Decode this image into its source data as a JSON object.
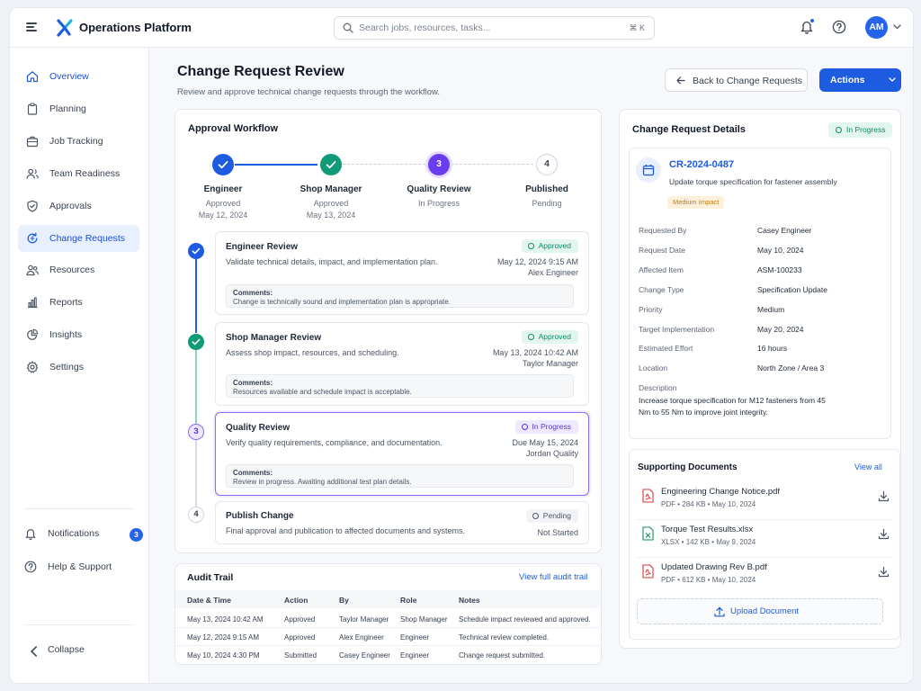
{
  "app": {
    "brand": "Operations Platform",
    "search_placeholder": "Search jobs, resources, tasks...",
    "search_shortcut": "⌘ K",
    "avatar_initials": "AM",
    "colors": {
      "primary": "#1d5be0",
      "success": "#0f9a78",
      "in_progress": "#6b3df0",
      "pending": "#cfd5de",
      "impact": "#f59e0b"
    }
  },
  "sidebar": {
    "items": [
      {
        "label": "Overview",
        "icon": "home-icon"
      },
      {
        "label": "Planning",
        "icon": "clipboard-icon"
      },
      {
        "label": "Job Tracking",
        "icon": "briefcase-icon"
      },
      {
        "label": "Team Readiness",
        "icon": "users-icon"
      },
      {
        "label": "Approvals",
        "icon": "shield-check-icon"
      },
      {
        "label": "Change Requests",
        "icon": "refresh-document-icon"
      },
      {
        "label": "Resources",
        "icon": "people-icon"
      },
      {
        "label": "Reports",
        "icon": "bar-chart-icon"
      },
      {
        "label": "Insights",
        "icon": "pie-chart-icon"
      },
      {
        "label": "Settings",
        "icon": "gear-icon"
      }
    ],
    "active_index": 5,
    "notifications_label": "Notifications",
    "notifications_count": "3",
    "help_label": "Help & Support",
    "collapse_label": "Collapse"
  },
  "header": {
    "title": "Change Request Review",
    "subtitle": "Review and approve technical change requests through the workflow.",
    "back_label": "Back to Change Requests",
    "actions_label": "Actions"
  },
  "workflow": {
    "title": "Approval Workflow",
    "steps": [
      {
        "name": "Engineer",
        "status": "Approved",
        "date": "May 12, 2024",
        "state": "done"
      },
      {
        "name": "Shop Manager",
        "status": "Approved",
        "date": "May 13, 2024",
        "state": "done"
      },
      {
        "name": "Quality Review",
        "status": "In Progress",
        "date": "",
        "number": "3",
        "state": "current"
      },
      {
        "name": "Published",
        "status": "Pending",
        "date": "",
        "number": "4",
        "state": "pending"
      }
    ],
    "reviews": [
      {
        "title": "Engineer Review",
        "desc": "Validate technical details, impact, and implementation plan.",
        "status": "Approved",
        "date": "May 12, 2024 9:15 AM",
        "who": "Alex Engineer",
        "comment_label": "Comments:",
        "comment": "Change is technically sound and implementation plan is appropriate."
      },
      {
        "title": "Shop Manager Review",
        "desc": "Assess shop impact, resources, and scheduling.",
        "status": "Approved",
        "date": "May 13, 2024 10:42 AM",
        "who": "Taylor Manager",
        "comment_label": "Comments:",
        "comment": "Resources available and schedule impact is acceptable."
      },
      {
        "number": "3",
        "title": "Quality Review",
        "desc": "Verify quality requirements, compliance, and documentation.",
        "status": "In Progress",
        "date": "Due May 15, 2024",
        "who": "Jordan Quality",
        "comment_label": "Comments:",
        "comment": "Review in progress. Awaiting additional test plan details."
      },
      {
        "number": "4",
        "title": "Publish Change",
        "desc": "Final approval and publication to affected documents and systems.",
        "status": "Pending",
        "date": "Not Started"
      }
    ]
  },
  "audit": {
    "title": "Audit Trail",
    "link": "View full audit trail",
    "columns": [
      "Date & Time",
      "Action",
      "By",
      "Role",
      "Notes"
    ],
    "rows": [
      [
        "May 13, 2024  10:42 AM",
        "Approved",
        "Taylor Manager",
        "Shop Manager",
        "Schedule impact reviewed and approved."
      ],
      [
        "May 12, 2024  9:15 AM",
        "Approved",
        "Alex Engineer",
        "Engineer",
        "Technical review completed."
      ],
      [
        "May 10, 2024  4:30 PM",
        "Submitted",
        "Casey Engineer",
        "Engineer",
        "Change request submitted."
      ]
    ]
  },
  "details": {
    "title": "Change Request Details",
    "status": "In Progress",
    "cr_id": "CR-2024-0487",
    "cr_summary": "Update torque specification for fastener assembly",
    "impact": "Medium Impact",
    "fields": [
      {
        "label": "Requested By",
        "value": "Casey Engineer"
      },
      {
        "label": "Request Date",
        "value": "May 10, 2024"
      },
      {
        "label": "Affected Item",
        "value": "ASM-100233"
      },
      {
        "label": "Change Type",
        "value": "Specification Update"
      },
      {
        "label": "Priority",
        "value": "Medium"
      },
      {
        "label": "Target Implementation",
        "value": "May 20, 2024"
      },
      {
        "label": "Estimated Effort",
        "value": "16 hours"
      },
      {
        "label": "Location",
        "value": "North Zone / Area 3"
      }
    ],
    "description_label": "Description",
    "description_line1": "Increase torque specification for M12 fasteners from 45",
    "description_line2": "Nm to 55 Nm to improve joint integrity."
  },
  "documents": {
    "title": "Supporting Documents",
    "view_all": "View all",
    "items": [
      {
        "name": "Engineering Change Notice.pdf",
        "meta": "PDF   •   284 KB   •   May 10, 2024",
        "type": "pdf"
      },
      {
        "name": "Torque Test Results.xlsx",
        "meta": "XLSX   •   142 KB   •   May 9, 2024",
        "type": "xlsx"
      },
      {
        "name": "Updated Drawing Rev B.pdf",
        "meta": "PDF   •   612 KB   •   May 10, 2024",
        "type": "pdf"
      }
    ],
    "upload_label": "Upload Document"
  }
}
